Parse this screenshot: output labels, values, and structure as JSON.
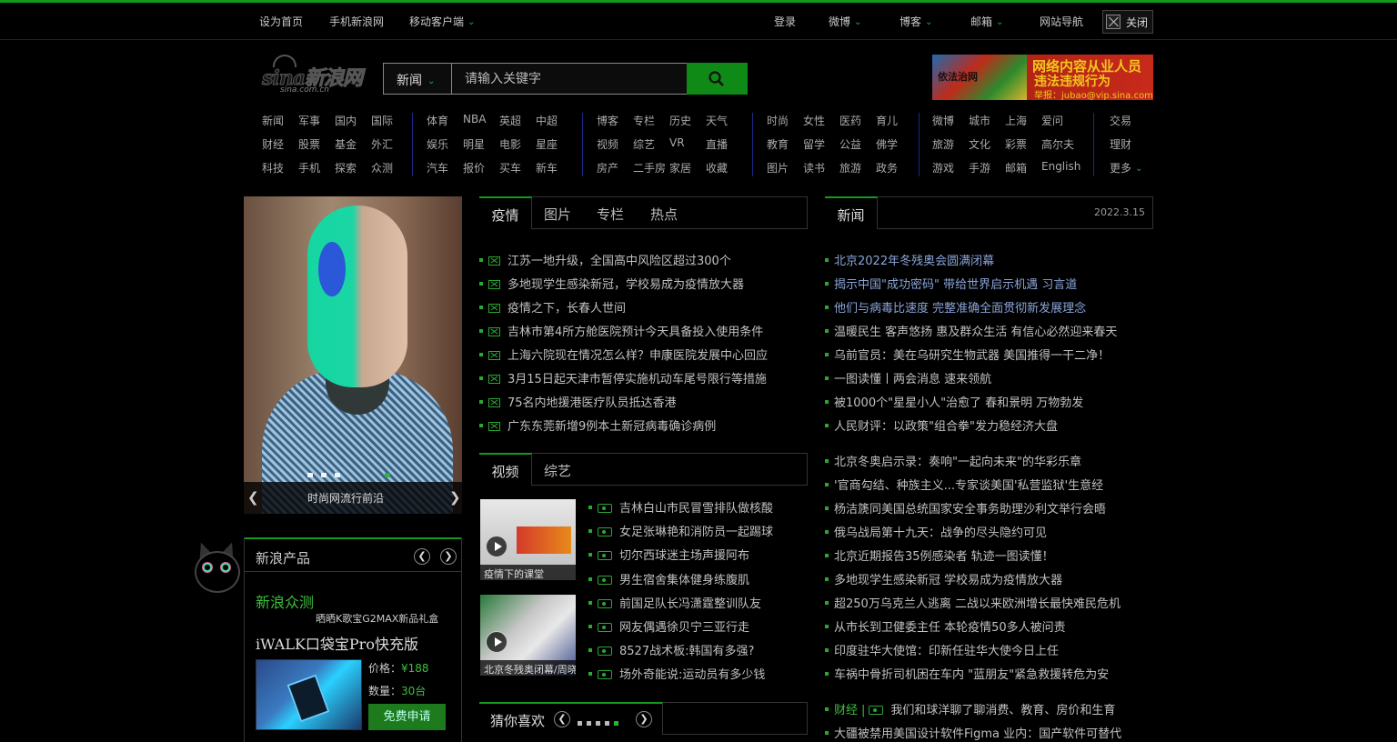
{
  "topbar": {
    "set_home": "设为首页",
    "mobile_sina": "手机新浪网",
    "mobile_client": "移动客户端",
    "login": "登录",
    "weibo": "微博",
    "blog": "博客",
    "mail": "邮箱",
    "site_nav": "网站导航",
    "close": "关闭"
  },
  "logo": {
    "main": "sina新浪网",
    "sub": "sina.com.cn"
  },
  "search": {
    "category": "新闻",
    "placeholder": "请输入关键字"
  },
  "ad": {
    "left_text": "依法治网",
    "line1": "网络内容从业人员",
    "line2": "违法违规行为",
    "line3": "举报：jubao@vip.sina.com"
  },
  "nav": {
    "g1": [
      [
        "新闻",
        "军事",
        "国内",
        "国际"
      ],
      [
        "财经",
        "股票",
        "基金",
        "外汇"
      ],
      [
        "科技",
        "手机",
        "探索",
        "众测"
      ]
    ],
    "g2": [
      [
        "体育",
        "NBA",
        "英超",
        "中超"
      ],
      [
        "娱乐",
        "明星",
        "电影",
        "星座"
      ],
      [
        "汽车",
        "报价",
        "买车",
        "新车"
      ]
    ],
    "g3": [
      [
        "博客",
        "专栏",
        "历史",
        "天气"
      ],
      [
        "视频",
        "综艺",
        "VR",
        "直播"
      ],
      [
        "房产",
        "二手房",
        "家居",
        "收藏"
      ]
    ],
    "g4": [
      [
        "时尚",
        "女性",
        "医药",
        "育儿"
      ],
      [
        "教育",
        "留学",
        "公益",
        "佛学"
      ],
      [
        "图片",
        "读书",
        "旅游",
        "政务"
      ]
    ],
    "g5": [
      [
        "微博",
        "城市",
        "上海",
        "爱问"
      ],
      [
        "旅游",
        "文化",
        "彩票",
        "高尔夫"
      ],
      [
        "游戏",
        "手游",
        "邮箱",
        "English"
      ]
    ],
    "g6": [
      "交易",
      "理财",
      "更多"
    ]
  },
  "slideshow": {
    "caption": "时尚网流行前沿"
  },
  "products": {
    "title": "新浪产品",
    "brand": "新浪众测",
    "sub": "晒晒K歌宝G2MAX新品礼盒",
    "name": "iWALK口袋宝Pro快充版",
    "price_label": "价格：",
    "price_value": "¥188",
    "qty_label": "数量：",
    "qty_value": "30台",
    "apply": "免费申请"
  },
  "news_tabs": [
    "疫情",
    "图片",
    "专栏",
    "热点"
  ],
  "news_list": [
    "江苏一地升级，全国高中风险区超过300个",
    "多地现学生感染新冠，学校易成为疫情放大器",
    "疫情之下，长春人世间",
    "吉林市第4所方舱医院预计今天具备投入使用条件",
    "上海六院现在情况怎么样？申康医院发展中心回应",
    "3月15日起天津市暂停实施机动车尾号限行等措施",
    "75名内地援港医疗队员抵达香港",
    "广东东莞新增9例本土新冠病毒确诊病例"
  ],
  "video_tabs": [
    "视频",
    "综艺"
  ],
  "video_thumbs": [
    "疫情下的课堂",
    "北京冬残奥闭幕/周晓"
  ],
  "video_list": [
    "吉林白山市民冒雪排队做核酸",
    "女足张琳艳和消防员一起踢球",
    "切尔西球迷主场声援阿布",
    "男生宿舍集体健身练腹肌",
    "前国足队长冯潇霆整训队友",
    "网友偶遇徐贝宁三亚行走",
    "8527战术板:韩国有多强?",
    "场外奇能说:运动员有多少钱"
  ],
  "guess": {
    "title": "猜你喜欢"
  },
  "right": {
    "tab": "新闻",
    "date": "2022.3.15",
    "headlines_blue": [
      "北京2022年冬残奥会圆满闭幕",
      "揭示中国\"成功密码\" 带给世界启示机遇 习言道",
      "他们与病毒比速度 完整准确全面贯彻新发展理念"
    ],
    "headlines_grey": [
      "温暖民生 客声悠扬 惠及群众生活 有信心必然迎来春天",
      "乌前官员：美在乌研究生物武器 美国推得一干二净！",
      "一图读懂丨两会消息 速来领航",
      "被1000个\"星星小人\"治愈了 春和景明 万物勃发",
      "人民财评：以政策\"组合拳\"发力稳经济大盘"
    ],
    "list2": [
      "北京冬奥启示录：奏响\"一起向未来\"的华彩乐章",
      "'官商勾结、种族主义...专家谈美国'私营监狱'生意经",
      "杨洁篪同美国总统国家安全事务助理沙利文举行会晤",
      "俄乌战局第十九天：战争的尽头隐约可见",
      "北京近期报告35例感染者 轨迹一图读懂！",
      "多地现学生感染新冠 学校易成为疫情放大器",
      "超250万乌克兰人逃离 二战以来欧洲增长最快难民危机",
      "从市长到卫健委主任 本轮疫情50多人被问责",
      "印度驻华大使馆：印新任驻华大使今日上任",
      "车祸中骨折司机困在车内 \"蓝朋友\"紧急救援转危为安"
    ],
    "finance_label": "财经",
    "finance_item": "我们和球洋聊了聊消费、教育、房价和生育",
    "last_item": "大疆被禁用美国设计软件Figma 业内：国产软件可替代"
  },
  "colors": {
    "accent": "#129a1a",
    "link_blue": "#8aa4d8",
    "brand_green": "#3fbf3f"
  }
}
